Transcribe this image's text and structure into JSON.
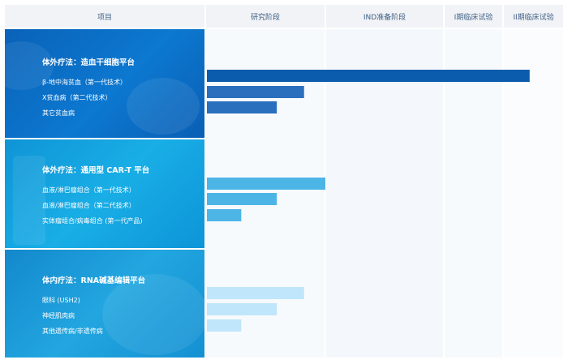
{
  "header": {
    "project": "项目",
    "stages": [
      "研究阶段",
      "IND准备阶段",
      "I期临床试验",
      "II期临床试验"
    ]
  },
  "colors": {
    "header_bg": "#f1f3f6",
    "header_text": "#3f5f86",
    "panel1": "#0b72c8",
    "panel2": "#12a3df",
    "panel3": "#1a9bd6"
  },
  "platforms": [
    {
      "title": "体外疗法：造血干细胞平台",
      "items": [
        "β-地中海贫血（第一代技术）",
        "X贫血病（第二代技术）",
        "其它贫血病"
      ]
    },
    {
      "title": "体外疗法：通用型 CAR-T 平台",
      "items": [
        "血液/淋巴瘤组合（第一代技术）",
        "血液/淋巴瘤组合（第二代技术）",
        "实体瘤组合/病毒组合 (第一代产品)"
      ]
    },
    {
      "title": "体内疗法：RNA碱基编辑平台",
      "items": [
        "眼科 (USH2)",
        "神经肌肉病",
        "其他遗传病/非遗传病"
      ]
    }
  ],
  "chart_data": {
    "type": "bar",
    "orientation": "horizontal",
    "x_axis": [
      "研究阶段",
      "IND准备阶段",
      "I期临床试验",
      "II期临床试验"
    ],
    "xlim": [
      0,
      4
    ],
    "bars": [
      {
        "category": "β-地中海贫血（第一代技术）",
        "value": 3.45,
        "color": "#0b5cad"
      },
      {
        "category": "X贫血病（第二代技术）",
        "value": 0.82,
        "color": "#2a6fbd"
      },
      {
        "category": "其它贫血病",
        "value": 0.59,
        "color": "#2a6fbd"
      },
      {
        "category": "血液/淋巴瘤组合（第一代技术）",
        "value": 1.0,
        "color": "#4db5e6"
      },
      {
        "category": "血液/淋巴瘤组合（第二代技术）",
        "value": 0.59,
        "color": "#4db5e6"
      },
      {
        "category": "实体瘤组合/病毒组合 (第一代产品)",
        "value": 0.29,
        "color": "#4db5e6"
      },
      {
        "category": "眼科 (USH2)",
        "value": 0.82,
        "color": "#bfe6fa"
      },
      {
        "category": "神经肌肉病",
        "value": 0.59,
        "color": "#bfe6fa"
      },
      {
        "category": "其他遗传病/非遗传病",
        "value": 0.29,
        "color": "#bfe6fa"
      }
    ]
  }
}
